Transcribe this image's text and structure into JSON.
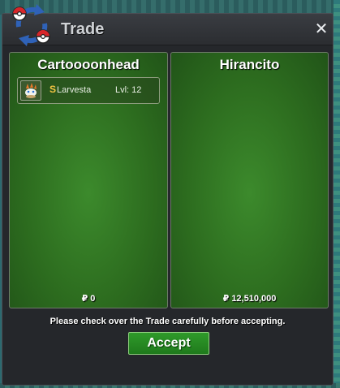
{
  "window": {
    "title": "Trade",
    "close_glyph": "✕"
  },
  "left_panel": {
    "player_name": "Cartoooonhead",
    "money": "₽ 0",
    "items": [
      {
        "shiny_marker": "S",
        "name": "Larvesta",
        "level": "Lvl: 12",
        "icon": "larvesta-sprite-icon"
      }
    ]
  },
  "right_panel": {
    "player_name": "Hirancito",
    "money": "₽ 12,510,000",
    "items": []
  },
  "footer": {
    "notice": "Please check over the Trade carefully before accepting.",
    "accept_label": "Accept"
  },
  "colors": {
    "panel_green": "#2d6d1f",
    "accept_green": "#1f7a1c",
    "shiny_gold": "#f5c542",
    "window_bg": "#25272b"
  }
}
